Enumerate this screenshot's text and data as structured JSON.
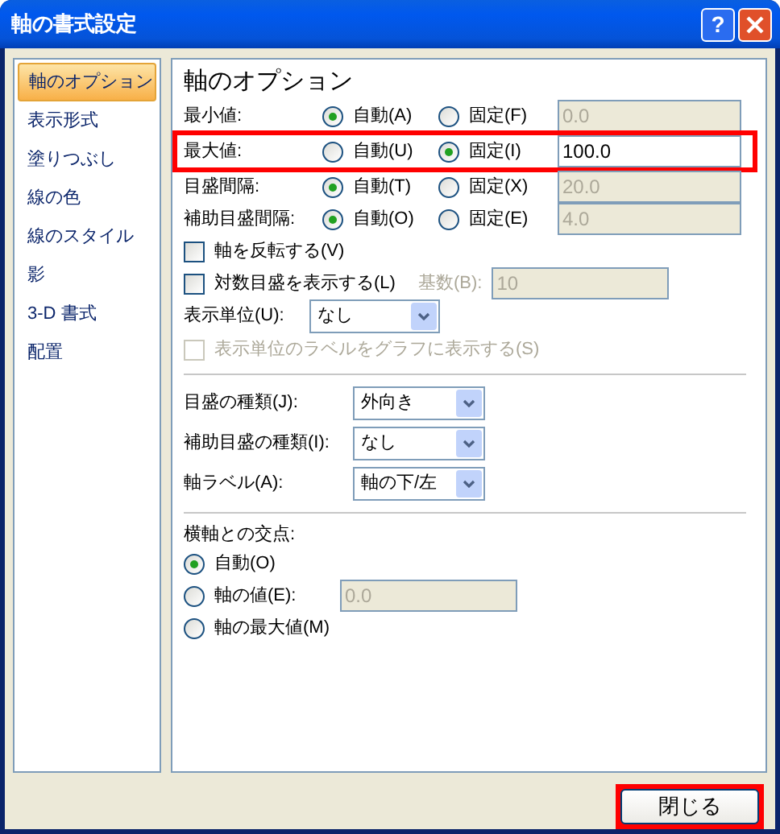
{
  "window": {
    "title": "軸の書式設定",
    "help_label": "?"
  },
  "sidebar": {
    "items": [
      {
        "label": "軸のオプション",
        "selected": true
      },
      {
        "label": "表示形式",
        "selected": false
      },
      {
        "label": "塗りつぶし",
        "selected": false
      },
      {
        "label": "線の色",
        "selected": false
      },
      {
        "label": "線のスタイル",
        "selected": false
      },
      {
        "label": "影",
        "selected": false
      },
      {
        "label": "3-D 書式",
        "selected": false
      },
      {
        "label": "配置",
        "selected": false
      }
    ]
  },
  "panel": {
    "title": "軸のオプション",
    "rows": [
      {
        "kind": "radio_pair",
        "label": "最小値:",
        "options": [
          {
            "label": "自動(A)",
            "selected": true
          },
          {
            "label": "固定(F)",
            "selected": false
          }
        ],
        "value": "0.0",
        "disabled": true,
        "highlighted": false
      },
      {
        "kind": "radio_pair",
        "label": "最大値:",
        "options": [
          {
            "label": "自動(U)",
            "selected": false
          },
          {
            "label": "固定(I)",
            "selected": true
          }
        ],
        "value": "100.0",
        "disabled": false,
        "highlighted": true
      },
      {
        "kind": "radio_pair",
        "label": "目盛間隔:",
        "options": [
          {
            "label": "自動(T)",
            "selected": true
          },
          {
            "label": "固定(X)",
            "selected": false
          }
        ],
        "value": "20.0",
        "disabled": true,
        "highlighted": false
      },
      {
        "kind": "radio_pair",
        "label": "補助目盛間隔:",
        "options": [
          {
            "label": "自動(O)",
            "selected": true
          },
          {
            "label": "固定(E)",
            "selected": false
          }
        ],
        "value": "4.0",
        "disabled": true,
        "highlighted": false
      },
      {
        "kind": "checkbox",
        "label": "軸を反転する(V)",
        "checked": false,
        "disabled": false
      },
      {
        "kind": "checkbox",
        "label": "対数目盛を表示する(L)",
        "checked": false,
        "disabled": false,
        "extra_label": "基数(B):",
        "value": "10"
      },
      {
        "kind": "select",
        "label": "表示単位(U):",
        "value": "なし",
        "narrow": true
      },
      {
        "kind": "checkbox",
        "label": "表示単位のラベルをグラフに表示する(S)",
        "checked": false,
        "disabled": true
      },
      {
        "kind": "divider"
      },
      {
        "kind": "select",
        "label": "目盛の種類(J):",
        "value": "外向き",
        "narrow": false
      },
      {
        "kind": "select",
        "label": "補助目盛の種類(I):",
        "value": "なし",
        "narrow": false
      },
      {
        "kind": "select",
        "label": "軸ラベル(A):",
        "value": "軸の下/左",
        "narrow": false
      },
      {
        "kind": "divider"
      },
      {
        "kind": "heading",
        "label": "横軸との交点:"
      },
      {
        "kind": "radio",
        "label": "自動(O)",
        "selected": true
      },
      {
        "kind": "radio",
        "label": "軸の値(E):",
        "selected": false,
        "value": "0.0"
      },
      {
        "kind": "radio",
        "label": "軸の最大値(M)",
        "selected": false
      }
    ]
  },
  "buttons": [
    {
      "label": "閉じる",
      "highlighted": true
    }
  ]
}
